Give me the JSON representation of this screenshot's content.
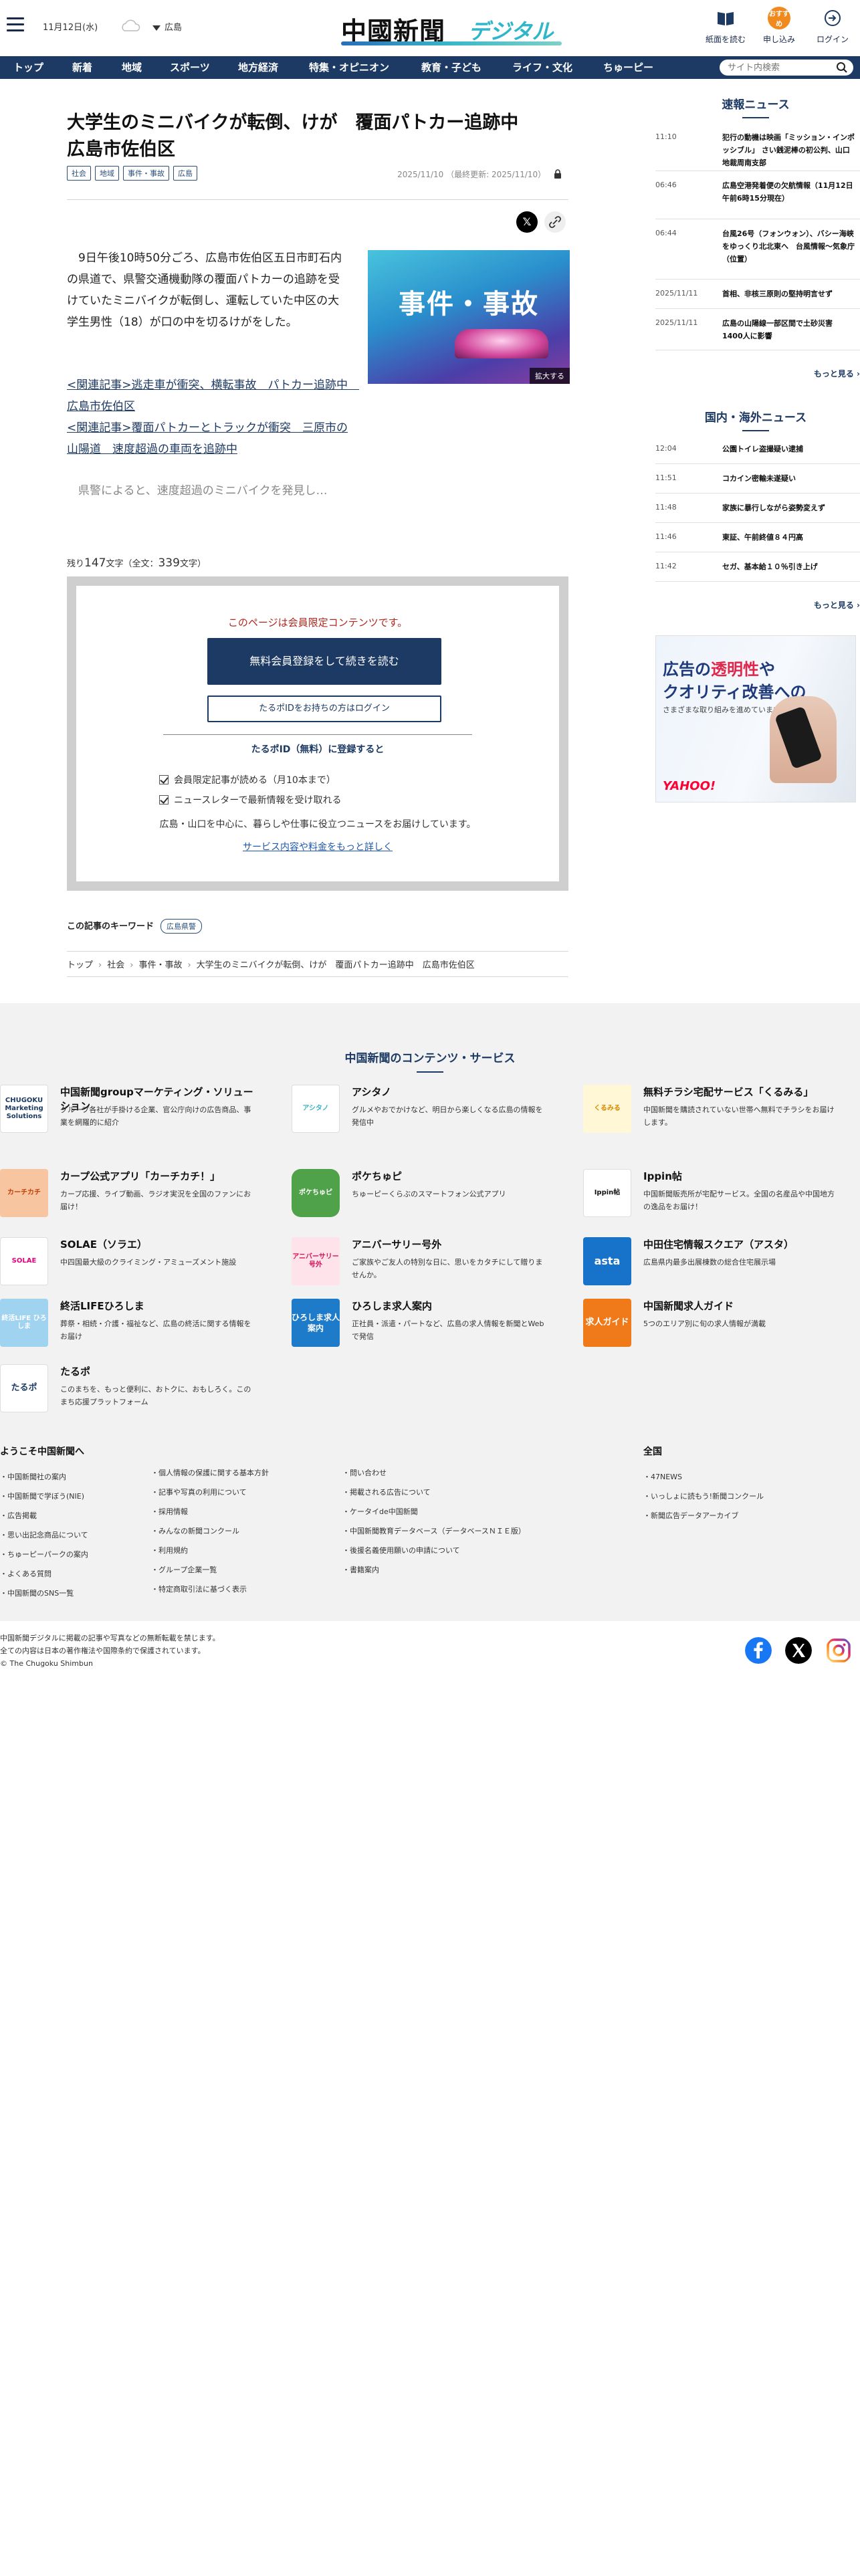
{
  "header": {
    "date": "11月12日(水)",
    "region": "広島",
    "logo_main": "中國新聞",
    "logo_sub": "デジタル",
    "buttons": [
      {
        "label": "紙面を読む",
        "icon": "newspaper-icon"
      },
      {
        "label": "申し込み",
        "icon": "subscribe-icon",
        "badge": "おすすめ"
      },
      {
        "label": "ログイン",
        "icon": "login-icon"
      }
    ]
  },
  "nav": {
    "items": [
      "トップ",
      "新着",
      "地域",
      "スポーツ",
      "地方経済",
      "特集・オピニオン",
      "教育・子ども",
      "ライフ・文化",
      "ちゅーピー"
    ],
    "search_placeholder": "サイト内検索"
  },
  "article": {
    "title_line1": "大学生のミニバイクが転倒、けが　覆面パトカー追跡中",
    "title_line2": "広島市佐伯区",
    "tags": [
      "社会",
      "地域",
      "事件・事故",
      "広島"
    ],
    "date": "2025/11/10",
    "updated": "（最終更新: 2025/11/10）",
    "body": "9日午後10時50分ごろ、広島市佐伯区五日市町石内の県道で、県警交通機動隊の覆面パトカーの追跡を受けていたミニバイクが転倒し、運転していた中区の大学生男性（18）が口の中を切るけがをした。",
    "related": [
      "<関連記事>逃走車が衝突、横転事故　パトカー追跡中　広島市佐伯区",
      "<関連記事>覆面パトカーとトラックが衝突　三原市の山陽道　速度超過の車両を追跡中"
    ],
    "teaser": "県警によると、速度超過のミニバイクを発見し…",
    "photo_caption": "事件・事故",
    "photo_enlarge": "拡大する",
    "remaining_prefix": "残り",
    "remaining_count": "147",
    "remaining_suffix": "文字（全文：",
    "total_count": "339",
    "total_suffix": "文字）",
    "paywall": {
      "note": "このページは会員限定コンテンツです。",
      "register_button": "無料会員登録をして続きを読む",
      "login_button": "たるポIDをお持ちの方はログイン",
      "benefit_heading": "たるポID（無料）に登録すると",
      "benefits": [
        "会員限定記事が読める（月10本まで）",
        "ニュースレターで最新情報を受け取れる"
      ],
      "description": "広島・山口を中心に、暮らしや仕事に役立つニュースをお届けしています。",
      "more_link": "サービス内容や料金をもっと詳しく"
    },
    "keyword_label": "この記事のキーワード",
    "keyword": "広島県警",
    "breadcrumb": [
      "トップ",
      "社会",
      "事件・事故",
      "大学生のミニバイクが転倒、けが　覆面パトカー追跡中　広島市佐伯区"
    ]
  },
  "sidebar": {
    "breaking_title": "速報ニュース",
    "breaking": [
      {
        "time": "11:10",
        "headline": "犯行の動機は映画「ミッション・インポッシブル」 さい銭泥棒の初公判、山口地裁周南支部"
      },
      {
        "time": "06:46",
        "headline": "広島空港発着便の欠航情報（11月12日午前6時15分現在）"
      },
      {
        "time": "06:44",
        "headline": "台風26号（フォンウォン）、バシー海峡をゆっくり北北東へ　台風情報～気象庁（位置）"
      },
      {
        "time": "2025/11/11",
        "headline": "首相、非核三原則の堅持明言せず"
      },
      {
        "time": "2025/11/11",
        "headline": "広島の山陽線一部区間で土砂災害　1400人に影響"
      }
    ],
    "more": "もっと見る",
    "world_title": "国内・海外ニュース",
    "world": [
      {
        "time": "12:04",
        "headline": "公園トイレ盗撮疑い逮捕"
      },
      {
        "time": "11:51",
        "headline": "コカイン密輸未遂疑い"
      },
      {
        "time": "11:48",
        "headline": "家族に暴行しながら姿勢変えず"
      },
      {
        "time": "11:46",
        "headline": "東証、午前終値８４円高"
      },
      {
        "time": "11:42",
        "headline": "セガ、基本給１０％引き上げ"
      }
    ],
    "ad": {
      "line1a": "広告の",
      "line1b": "透明性",
      "line1c": "や",
      "line2": "クオリティ改善への",
      "line3": "さまざまな取り組みを進めています。",
      "brand": "YAHOO!"
    }
  },
  "services": {
    "title": "中国新聞のコンテンツ・サービス",
    "items": [
      {
        "name": "中国新聞groupマーケティング・ソリューション",
        "desc": "グループ各社が手掛ける企業、官公庁向けの広告商品、事業を網羅的に紹介",
        "logo": "CHUGOKU Marketing Solutions"
      },
      {
        "name": "アシタノ",
        "desc": "グルメやおでかけなど、明日から楽しくなる広島の情報を発信中",
        "logo": "アシタノ"
      },
      {
        "name": "無料チラシ宅配サービス「くるみる」",
        "desc": "中国新聞を購読されていない世帯へ無料でチラシをお届けします。",
        "logo": "くるみる"
      },
      {
        "name": "カープ公式アプリ「カーチカチ！」",
        "desc": "カープ応援、ライブ動画、ラジオ実況を全国のファンにお届け！",
        "logo": "カーチカチ"
      },
      {
        "name": "ポケちゅピ",
        "desc": "ちゅーピーくらぶのスマートフォン公式アプリ",
        "logo": "ポケちゅピ"
      },
      {
        "name": "Ippin帖",
        "desc": "中国新聞販売所が宅配サービス。全国の名産品や中国地方の逸品をお届け！",
        "logo": "Ippin帖"
      },
      {
        "name": "SOLAE（ソラエ）",
        "desc": "中四国最大級のクライミング・アミューズメント施設",
        "logo": "SOLAE"
      },
      {
        "name": "アニバーサリー号外",
        "desc": "ご家族やご友人の特別な日に、思いをカタチにして贈りませんか。",
        "logo": "アニバーサリー号外"
      },
      {
        "name": "中田住宅情報スクエア（アスタ）",
        "desc": "広島県内最多出展棟数の総合住宅展示場",
        "logo": "asta"
      },
      {
        "name": "終活LIFEひろしま",
        "desc": "葬祭・相続・介護・福祉など、広島の終活に関する情報をお届け",
        "logo": "終活LIFE ひろしま"
      },
      {
        "name": "ひろしま求人案内",
        "desc": "正社員・派遣・パートなど、広島の求人情報を新聞とWebで発信",
        "logo": "ひろしま求人案内"
      },
      {
        "name": "中国新聞求人ガイド",
        "desc": "5つのエリア別に旬の求人情報が満載",
        "logo": "求人ガイド"
      },
      {
        "name": "たるポ",
        "desc": "このまちを、もっと便利に、おトクに、おもしろく。このまち応援プラットフォーム",
        "logo": "たるポ"
      }
    ]
  },
  "footer": {
    "welcome_title": "ようこそ中国新聞へ",
    "col1": [
      "中国新聞社の案内",
      "中国新聞で学ぼう(NIE)",
      "広告掲載",
      "思い出記念商品について",
      "ちゅーピーパークの案内",
      "よくある質問",
      "中国新聞のSNS一覧"
    ],
    "col2": [
      "個人情報の保護に関する基本方針",
      "記事や写真の利用について",
      "採用情報",
      "みんなの新聞コンクール",
      "利用規約",
      "グループ企業一覧",
      "特定商取引法に基づく表示"
    ],
    "col3": [
      "問い合わせ",
      "掲載される広告について",
      "ケータイde中国新聞",
      "中国新聞教育データベース（データベースＮＩＥ版）",
      "後援名義使用願いの申請について",
      "書籍案内"
    ],
    "national_title": "全国",
    "national": [
      "47NEWS",
      "いっしょに読もう!新聞コンクール",
      "新聞広告データアーカイブ"
    ],
    "copyright1": "中国新聞デジタルに掲載の記事や写真などの無断転載を禁じます。",
    "copyright2": "全ての内容は日本の著作権法や国際条約で保護されています。",
    "copyright3": "© The Chugoku Shimbun"
  },
  "colors": {
    "navy": "#1c3a63",
    "accent_orange": "#f08a1c",
    "alert_red": "#b3261e"
  }
}
